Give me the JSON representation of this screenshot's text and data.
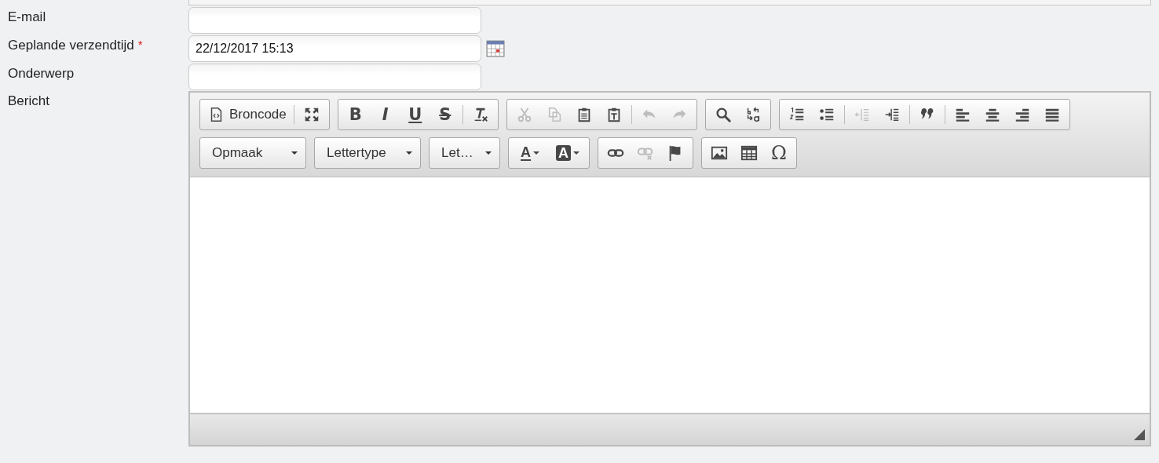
{
  "fields": [
    {
      "kind": "text",
      "label": "E-mail"
    },
    {
      "kind": "datetime",
      "label": "Geplande verzendtijd",
      "required_mark": "*",
      "value": "22/12/2017 15:13"
    },
    {
      "kind": "text",
      "label": "Onderwerp"
    }
  ],
  "editor": {
    "label": "Bericht",
    "toolbar": [
      [
        [
          {
            "kind": "labeled",
            "label": "Broncode",
            "disabled": false
          },
          {
            "kind": "separator"
          },
          {
            "kind": "icon",
            "disabled": false
          }
        ],
        [
          {
            "kind": "bold",
            "label": "B",
            "disabled": false
          },
          {
            "kind": "italic",
            "label": "I",
            "disabled": false
          },
          {
            "kind": "underline",
            "label": "U",
            "disabled": false
          },
          {
            "kind": "strikethrough",
            "label": "S",
            "disabled": false
          },
          {
            "kind": "separator"
          },
          {
            "kind": "icon",
            "disabled": false
          }
        ],
        [
          {
            "kind": "icon",
            "disabled": true
          },
          {
            "kind": "icon",
            "disabled": true
          },
          {
            "kind": "icon",
            "disabled": false
          },
          {
            "kind": "icon",
            "disabled": false
          },
          {
            "kind": "separator"
          },
          {
            "kind": "icon",
            "disabled": true
          },
          {
            "kind": "icon",
            "disabled": true
          }
        ],
        [
          {
            "kind": "icon",
            "disabled": false
          },
          {
            "kind": "icon",
            "disabled": false
          }
        ],
        [
          {
            "kind": "icon",
            "disabled": false
          },
          {
            "kind": "icon",
            "disabled": false
          },
          {
            "kind": "separator"
          },
          {
            "kind": "icon",
            "disabled": true
          },
          {
            "kind": "icon",
            "disabled": false
          },
          {
            "kind": "separator"
          },
          {
            "kind": "icon",
            "disabled": false
          },
          {
            "kind": "separator"
          },
          {
            "kind": "icon",
            "disabled": false
          },
          {
            "kind": "icon",
            "disabled": false
          },
          {
            "kind": "icon",
            "disabled": false
          },
          {
            "kind": "icon",
            "disabled": false
          }
        ]
      ],
      [
        [
          {
            "kind": "dropdown",
            "label": "Opmaak"
          }
        ],
        [
          {
            "kind": "dropdown",
            "label": "Lettertype"
          }
        ],
        [
          {
            "kind": "dropdown",
            "label": "Let…"
          }
        ],
        [
          {
            "kind": "text-color",
            "label": "A",
            "disabled": false
          },
          {
            "kind": "background-color",
            "label": "A",
            "disabled": false
          }
        ],
        [
          {
            "kind": "icon",
            "disabled": false
          },
          {
            "kind": "icon",
            "disabled": true
          },
          {
            "kind": "icon",
            "disabled": false
          }
        ],
        [
          {
            "kind": "icon",
            "disabled": false
          },
          {
            "kind": "icon",
            "disabled": false
          },
          {
            "kind": "special-character",
            "label": "Ω",
            "disabled": false
          }
        ]
      ]
    ]
  }
}
